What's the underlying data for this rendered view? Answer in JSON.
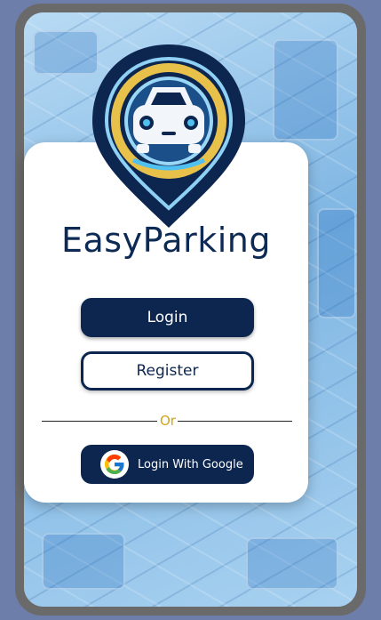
{
  "app": {
    "title": "EasyParking"
  },
  "actions": {
    "login_label": "Login",
    "register_label": "Register",
    "divider_text": "Or",
    "google_label": "Login With Google"
  },
  "icons": {
    "logo": "map-pin-car-logo",
    "google": "google-g-icon"
  },
  "colors": {
    "primary": "#0d2650",
    "accent": "#d4a419",
    "frame_bg": "#6e7eab"
  }
}
